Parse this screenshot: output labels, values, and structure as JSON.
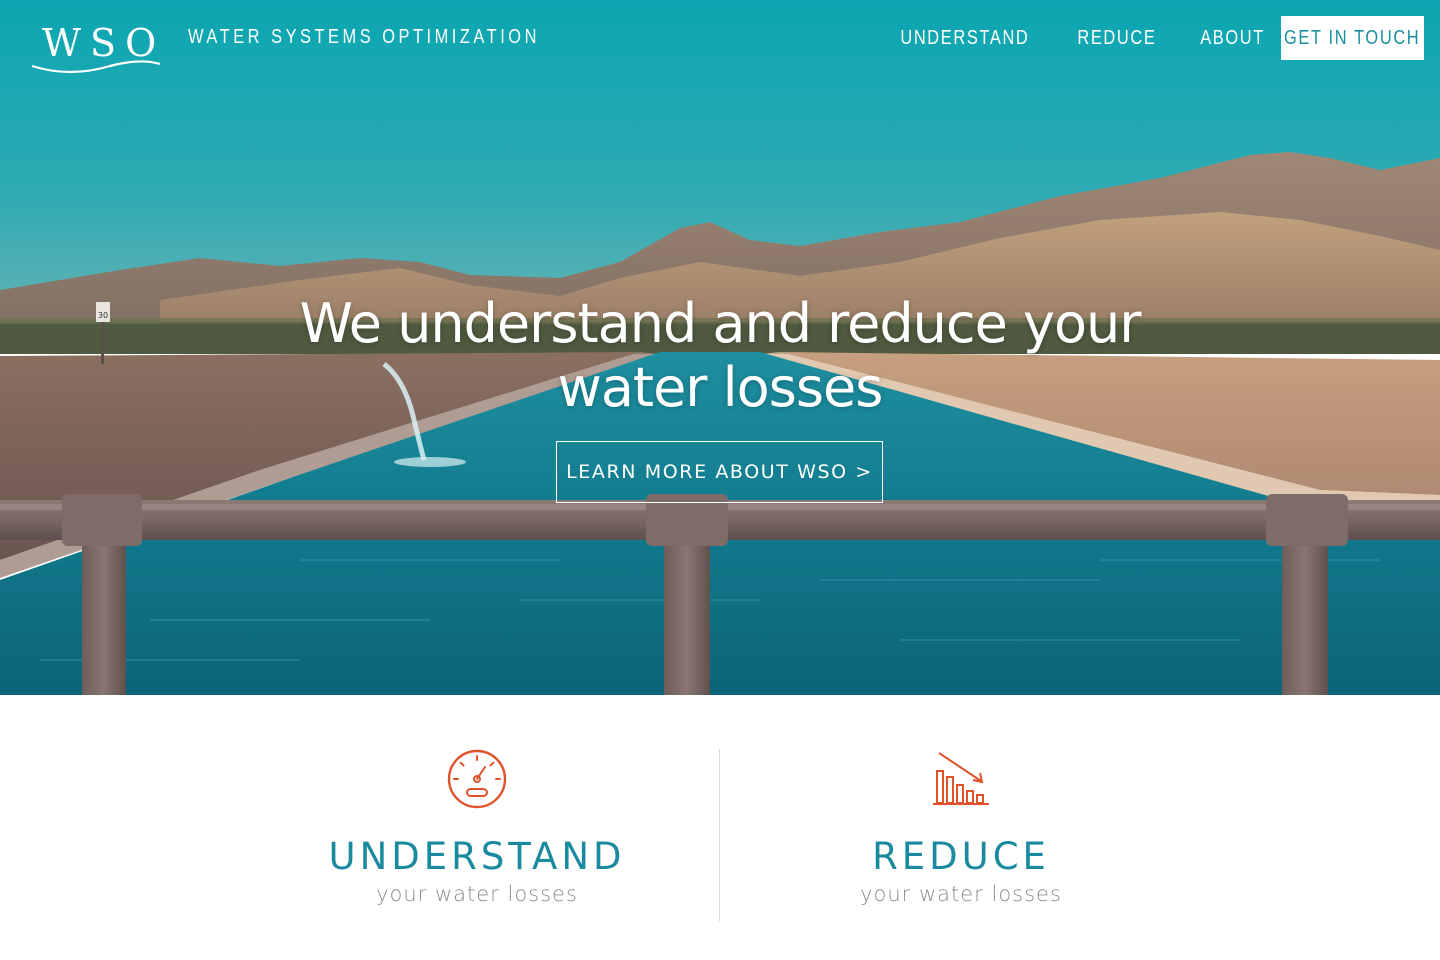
{
  "brand": {
    "logo_text": "WSO",
    "site_title": "WATER SYSTEMS OPTIMIZATION"
  },
  "nav": {
    "items": [
      {
        "label": "UNDERSTAND"
      },
      {
        "label": "REDUCE"
      },
      {
        "label": "ABOUT"
      }
    ],
    "cta_label": "GET IN TOUCH"
  },
  "hero": {
    "heading_line1": "We understand and reduce your",
    "heading_line2": "water losses",
    "button_label": "LEARN MORE ABOUT WSO >",
    "sign_number": "30"
  },
  "features": [
    {
      "title": "UNDERSTAND",
      "subtitle": "your water losses",
      "icon": "gauge-icon"
    },
    {
      "title": "REDUCE",
      "subtitle": "your water losses",
      "icon": "declining-bar-chart-icon"
    }
  ],
  "colors": {
    "accent": "#1a8a9e",
    "icon_orange": "#e0532b",
    "sky": "#0fa3ae",
    "water": "#117f92",
    "white": "#ffffff",
    "subtitle_gray": "#8c8c8c"
  }
}
